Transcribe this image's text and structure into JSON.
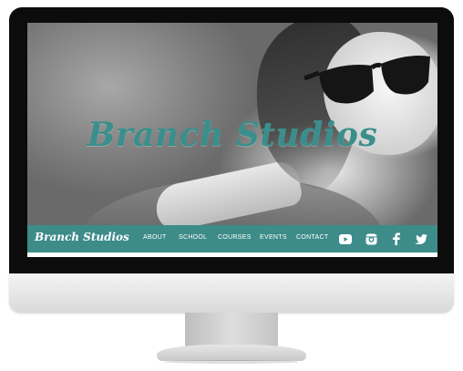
{
  "site": {
    "hero_title": "Branch Studios",
    "logo_text": "Branch Studios",
    "brand_color": "#3d8c8a"
  },
  "nav": {
    "items": [
      {
        "label": "ABOUT"
      },
      {
        "label": "SCHOOL"
      },
      {
        "label": "COURSES"
      },
      {
        "label": "EVENTS"
      },
      {
        "label": "CONTACT"
      }
    ],
    "social": [
      {
        "icon": "youtube-icon"
      },
      {
        "icon": "instagram-icon"
      },
      {
        "icon": "facebook-icon"
      },
      {
        "icon": "twitter-icon"
      }
    ]
  }
}
